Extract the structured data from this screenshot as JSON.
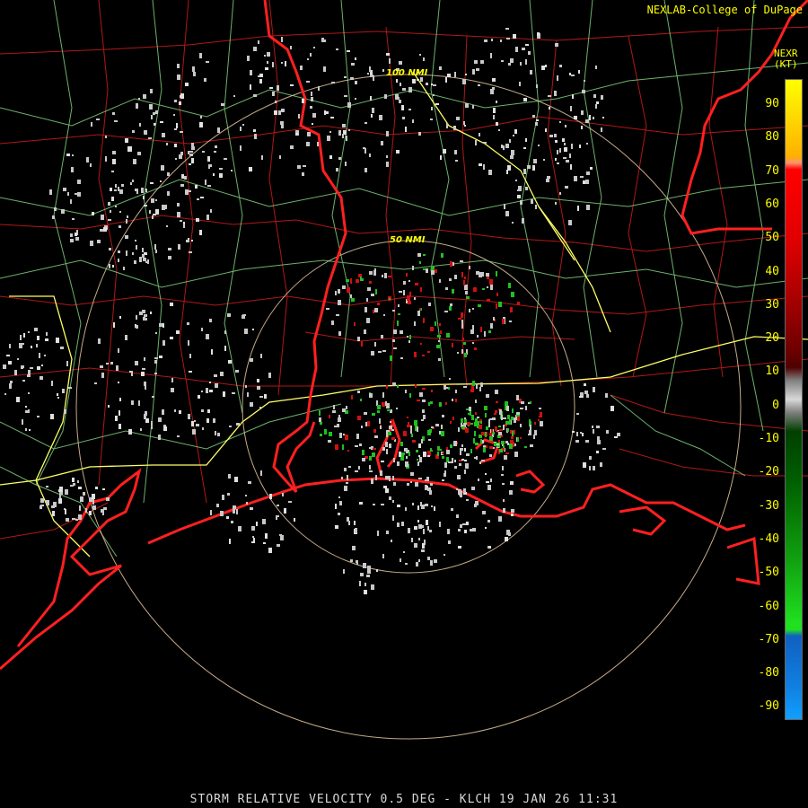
{
  "credit": "NEXLAB-College of DuPage",
  "product": {
    "code": "NEXR",
    "unit": "(KT)"
  },
  "rings": [
    "100 NMI",
    "50 NMI"
  ],
  "legend": {
    "ticks": [
      "90",
      "80",
      "70",
      "60",
      "50",
      "40",
      "30",
      "20",
      "10",
      "0",
      "-10",
      "-20",
      "-30",
      "-40",
      "-50",
      "-60",
      "-70",
      "-80",
      "-90"
    ]
  },
  "footer": "STORM RELATIVE VELOCITY 0.5 DEG - KLCH 19 JAN 26 11:31",
  "colors": {
    "coast": "#ff2020",
    "county": "#b01818",
    "highway": "#7fd27f",
    "interstate": "#ffff66",
    "ring": "#e8c8a0",
    "echo_gray": "#c8c8c8",
    "echo_green": "#20c020",
    "echo_red": "#d01010"
  }
}
